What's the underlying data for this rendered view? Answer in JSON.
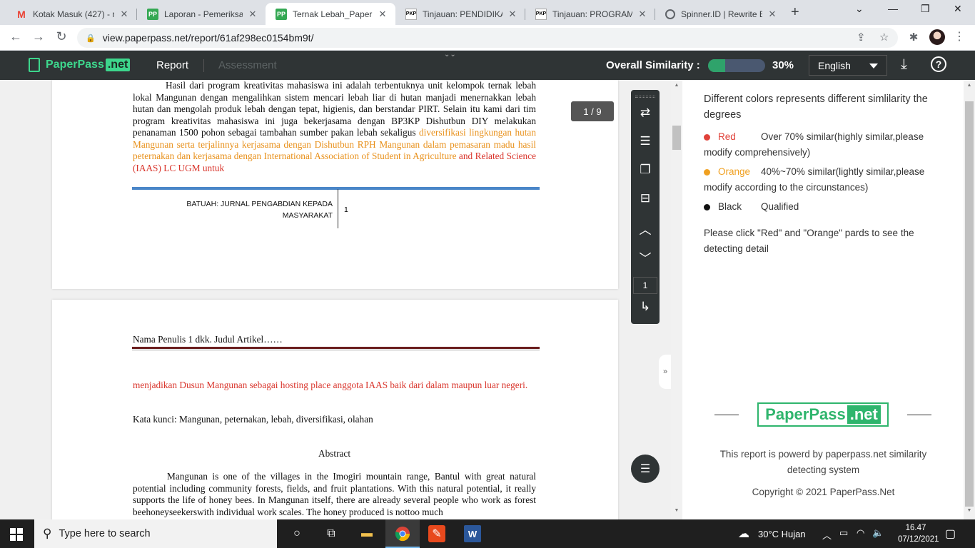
{
  "browser": {
    "tabs": [
      {
        "title": "Kotak Masuk (427) - m",
        "icon": "gmail-icon"
      },
      {
        "title": "Laporan - Pemeriksa P",
        "icon": "paperpass-icon"
      },
      {
        "title": "Ternak Lebah_PaperPa",
        "icon": "paperpass-icon",
        "active": true
      },
      {
        "title": "Tinjauan: PENDIDIKAN",
        "icon": "pkp-icon"
      },
      {
        "title": "Tinjauan: PROGRAM K",
        "icon": "pkp-icon"
      },
      {
        "title": "Spinner.ID | Rewrite En",
        "icon": "spinner-icon"
      }
    ],
    "favicon_pp": "PP",
    "favicon_pkp": "PKP",
    "url": "view.paperpass.net/report/61af298ec0154bm9t/"
  },
  "header": {
    "logo_name": "PaperPass",
    "logo_suffix": ".net",
    "tab_report": "Report",
    "tab_assessment": "Assessment",
    "similarity_label": "Overall Similarity :",
    "similarity_value": "30%",
    "similarity_fraction": 0.3,
    "language": "English"
  },
  "document": {
    "page_indicator": "1 / 9",
    "page1": {
      "para_black": "Hasil dari program kreativitas mahasiswa ini adalah terbentuknya unit kelompok ternak lebah lokal Mangunan dengan mengalihkan sistem mencari lebah liar di hutan manjadi menernakkan lebah hutan dan mengolah produk lebah dengan tepat, higienis,  dan berstandar PIRT. Selain itu kami dari tim program kreativitas mahasiswa ini juga bekerjasama dengan BP3KP Dishutbun DIY melakukan penanaman 1500 pohon sebagai tambahan sumber pakan lebah sekaligus ",
      "para_orange": "diversifikasi lingkungan hutan Mangunan serta terjalinnya kerjasama dengan Dishutbun RPH Mangunan dalam pemasaran madu hasil peternakan dan kerjasama dengan International Association of Student in Agriculture",
      "para_red": " and Related Science (IAAS) LC UGM untuk",
      "footer_journal": "BATUAH: JURNAL PENGABDIAN KEPADA MASYARAKAT",
      "footer_page": "1"
    },
    "page2": {
      "running_head": "Nama Penulis 1 dkk. Judul Artikel……",
      "para_red": "menjadikan Dusun Mangunan sebagai hosting place anggota IAAS baik dari dalam maupun luar negeri.",
      "keywords": "Kata kunci: Mangunan, peternakan, lebah, diversifikasi,  olahan",
      "abstract_title": "Abstract",
      "abstract_text": "Mangunan is one of the villages in the Imogiri mountain range, Bantul with great natural potential including community forests, fields, and fruit plantations. With this natural potential, it really supports the life of honey bees. In Mangunan itself, there are already several people who work as forest beehoneyseekerswith individual work scales. The honey produced is nottoo much"
    }
  },
  "toolbar": {
    "page_input": "1"
  },
  "panel": {
    "title": "Different colors represents different simlilarity the degrees",
    "legend": [
      {
        "name": "Red",
        "desc": "Over 70% similar(highly similar,please modify comprehensively)",
        "color": "#e0423a"
      },
      {
        "name": "Orange",
        "desc": "40%~70% similar(lightly similar,please modify according to the circunstances)",
        "color": "#f0a020"
      },
      {
        "name": "Black",
        "desc": "Qualified",
        "color": "#111111"
      }
    ],
    "hint": "Please click \"Red\" and \"Orange\" pards to see the detecting detail",
    "logo_name": "PaperPass",
    "logo_suffix": ".net",
    "powered": "This report is powerd by paperpass.net similarity detecting system",
    "copyright": "Copyright © 2021 PaperPass.Net"
  },
  "taskbar": {
    "search_placeholder": "Type here to search",
    "weather": "30°C  Hujan",
    "time": "16.47",
    "date": "07/12/2021"
  }
}
